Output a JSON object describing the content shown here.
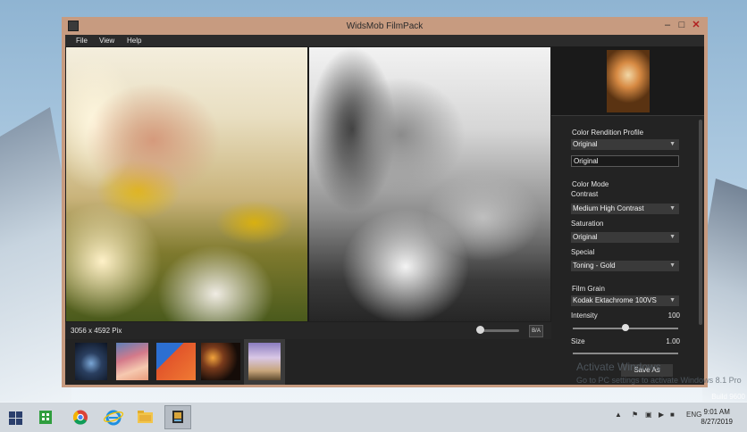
{
  "window": {
    "title": "WidsMob FilmPack",
    "minimize": "–",
    "maximize": "□",
    "close": "✕"
  },
  "menu": [
    "File",
    "View",
    "Help"
  ],
  "status": {
    "dimensions": "3056 x 4592 Pix",
    "ba_label": "B/A",
    "zoom_fraction": 0.05
  },
  "panel": {
    "color_rendition_label": "Color Rendition Profile",
    "color_rendition_value": "Original",
    "color_rendition_field": "Original",
    "color_mode_label": "Color Mode",
    "contrast_label": "Contrast",
    "contrast_value": "Medium High Contrast",
    "saturation_label": "Saturation",
    "saturation_value": "Original",
    "special_label": "Special",
    "special_value": "Toning - Gold",
    "film_grain_label": "Film Grain",
    "film_grain_value": "Kodak Ektachrome 100VS",
    "intensity_label": "Intensity",
    "intensity_value": "100",
    "intensity_fraction": 0.5,
    "size_label": "Size",
    "size_value": "1.00",
    "save_as": "Save As"
  },
  "overlay": {
    "activate_line1": "Activate Windows",
    "activate_line2": "Go to PC settings to activate Windows 8.1 Pro",
    "build": "Build 9600"
  },
  "taskbar": {
    "language": "ENG",
    "time": "9:01 AM",
    "date": "8/27/2019"
  },
  "icons": {
    "start": "windows-start-icon",
    "store": "store-icon",
    "chrome": "chrome-icon",
    "ie": "internet-explorer-icon",
    "explorer": "file-explorer-icon",
    "filmpack": "filmpack-icon"
  }
}
